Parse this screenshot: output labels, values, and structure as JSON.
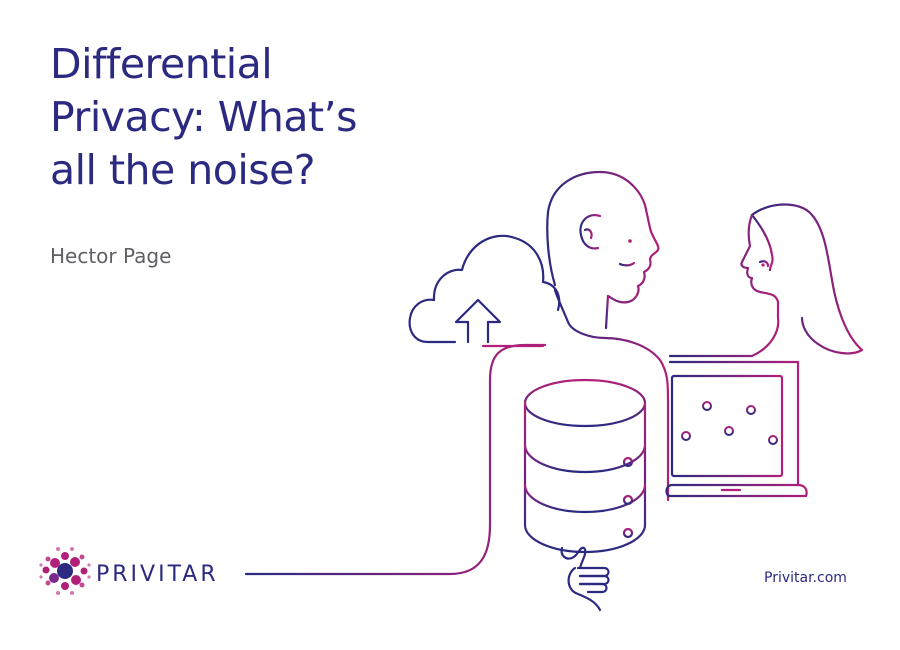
{
  "slide": {
    "title_lines": [
      "Differential",
      "Privacy: What’s",
      "all the noise?"
    ],
    "author": "Hector Page",
    "brand_name": "PRIVITAR",
    "website": "Privitar.com"
  },
  "colors": {
    "navy": "#2b2a80",
    "magenta": "#b0207a",
    "purple": "#7a2a8a",
    "gray_text": "#5f5f66"
  },
  "icons": [
    "cloud-upload-icon",
    "man-profile-icon",
    "woman-profile-icon",
    "database-icon",
    "hand-icon",
    "laptop-icon",
    "sliders-icon",
    "privitar-logo-icon"
  ]
}
